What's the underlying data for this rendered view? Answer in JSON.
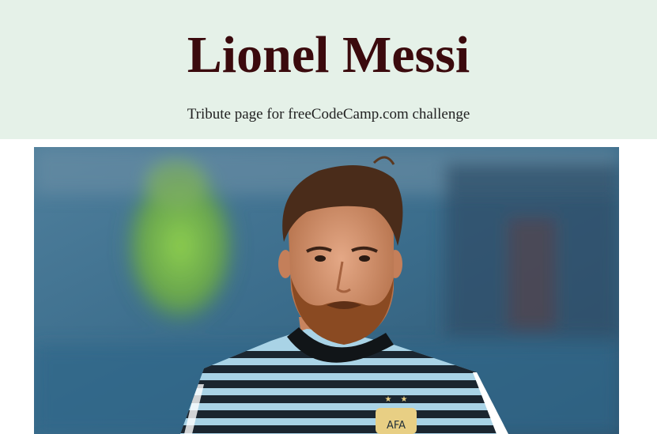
{
  "header": {
    "title": "Lionel Messi",
    "subtitle": "Tribute page for freeCodeCamp.com challenge"
  },
  "image": {
    "subject": "lionel-messi-photo",
    "colors": {
      "header_bg": "#e5f1e8",
      "title": "#3b0a0d",
      "stadium_blue": "#3d6e8e",
      "green_blur": "#7fc24a",
      "hair": "#4a2c1a",
      "beard": "#8a4a22",
      "skin": "#d99a78",
      "jersey_light": "#a9d3e6",
      "jersey_dark": "#1b2630"
    }
  }
}
